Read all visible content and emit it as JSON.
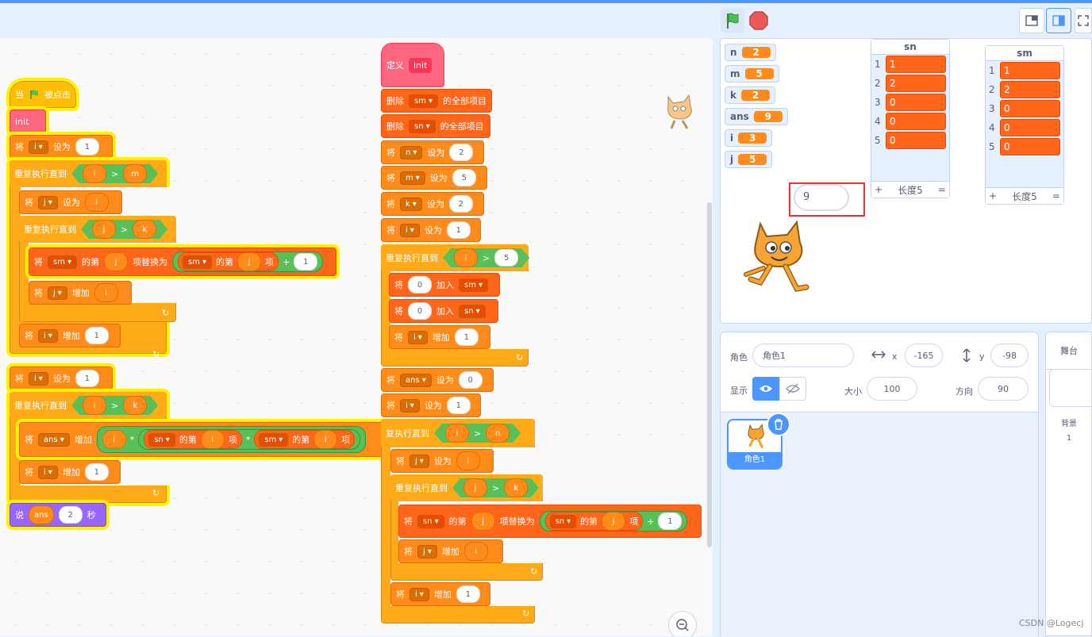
{
  "toolbar": {
    "flag": "green-flag",
    "stop": "stop-sign"
  },
  "script_main": {
    "hat": {
      "when": "当",
      "clicked": "被点击"
    },
    "call_init": "init",
    "set_i1": {
      "label": "将",
      "var": "i",
      "to": "设为",
      "value": "1"
    },
    "repeat1": {
      "label": "重复执行直到",
      "a": "i",
      "op": ">",
      "b": "m"
    },
    "set_j_i": {
      "label": "将",
      "var": "j",
      "to": "设为",
      "value": "i"
    },
    "repeat2": {
      "label": "重复执行直到",
      "a": "j",
      "op": ">",
      "b": "k"
    },
    "replace": {
      "label": "将",
      "list": "sm",
      "of": "的第",
      "idx": "j",
      "replace": "项替换为",
      "list2": "sm",
      "of2": "的第",
      "idx2": "j",
      "item": "项",
      "plus": "+",
      "num": "1"
    },
    "inc_j": {
      "label": "将",
      "var": "j",
      "inc": "增加",
      "value": "i"
    },
    "inc_i": {
      "label": "将",
      "var": "i",
      "inc": "增加",
      "value": "1"
    },
    "set_i2": {
      "label": "将",
      "var": "i",
      "to": "设为",
      "value": "1"
    },
    "repeat3": {
      "label": "重复执行直到",
      "a": "i",
      "op": ">",
      "b": "k"
    },
    "inc_ans": {
      "label": "将",
      "var": "ans",
      "inc": "增加",
      "a": "i",
      "mul": "*",
      "l1": "sn",
      "of1": "的第",
      "i1": "i",
      "item1": "项",
      "mul2": "*",
      "l2": "sm",
      "of2": "的第",
      "i2": "i",
      "item2": "项"
    },
    "inc_i2": {
      "label": "将",
      "var": "i",
      "inc": "增加",
      "value": "1"
    },
    "say": {
      "label": "说",
      "var": "ans",
      "secs": "2",
      "unit": "秒"
    }
  },
  "script_init": {
    "define": {
      "label": "定义",
      "name": "init"
    },
    "del_sm": {
      "label": "删除",
      "list": "sm",
      "rest": "的全部项目"
    },
    "del_sn": {
      "label": "删除",
      "list": "sn",
      "rest": "的全部项目"
    },
    "set_n": {
      "label": "将",
      "var": "n",
      "to": "设为",
      "value": "2"
    },
    "set_m": {
      "label": "将",
      "var": "m",
      "to": "设为",
      "value": "5"
    },
    "set_k": {
      "label": "将",
      "var": "k",
      "to": "设为",
      "value": "2"
    },
    "set_i": {
      "label": "将",
      "var": "i",
      "to": "设为",
      "value": "1"
    },
    "repeat1": {
      "label": "重复执行直到",
      "a": "i",
      "op": ">",
      "b": "5"
    },
    "add_sm": {
      "label": "将",
      "value": "0",
      "add": "加入",
      "list": "sm"
    },
    "add_sn": {
      "label": "将",
      "value": "0",
      "add": "加入",
      "list": "sn"
    },
    "inc_i": {
      "label": "将",
      "var": "i",
      "inc": "增加",
      "value": "1"
    },
    "set_ans": {
      "label": "将",
      "var": "ans",
      "to": "设为",
      "value": "0"
    },
    "set_i2": {
      "label": "将",
      "var": "i",
      "to": "设为",
      "value": "1"
    },
    "repeat2": {
      "label": "复执行直到",
      "a": "i",
      "op": ">",
      "b": "n"
    },
    "set_j": {
      "label": "将",
      "var": "j",
      "to": "设为",
      "value": "i"
    },
    "repeat3": {
      "label": "重复执行直到",
      "a": "j",
      "op": ">",
      "b": "k"
    },
    "replace": {
      "label": "将",
      "list": "sn",
      "of": "的第",
      "idx": "j",
      "replace": "项替换为",
      "list2": "sn",
      "of2": "的第",
      "idx2": "j",
      "item": "项",
      "plus": "+",
      "num": "1"
    },
    "inc_j": {
      "label": "将",
      "var": "j",
      "inc": "增加",
      "value": "i"
    },
    "inc_i2": {
      "label": "将",
      "var": "i",
      "inc": "增加",
      "value": "1"
    }
  },
  "monitors": [
    {
      "name": "n",
      "value": "2"
    },
    {
      "name": "m",
      "value": "5"
    },
    {
      "name": "k",
      "value": "2"
    },
    {
      "name": "ans",
      "value": "9"
    },
    {
      "name": "i",
      "value": "3"
    },
    {
      "name": "j",
      "value": "5"
    }
  ],
  "list_sn": {
    "title": "sn",
    "items": [
      "1",
      "2",
      "0",
      "0",
      "0"
    ],
    "indexes": [
      "1",
      "2",
      "3",
      "4",
      "5"
    ],
    "add": "+",
    "length": "长度5",
    "resize": "="
  },
  "list_sm": {
    "title": "sm",
    "items": [
      "1",
      "2",
      "0",
      "0",
      "0"
    ],
    "indexes": [
      "1",
      "2",
      "3",
      "4",
      "5"
    ],
    "add": "+",
    "length": "长度5",
    "resize": "="
  },
  "speech": "9",
  "sprite_info": {
    "sprite_label": "角色",
    "sprite_name": "角色1",
    "x_label": "x",
    "x": "-165",
    "y_label": "y",
    "y": "-98",
    "show_label": "显示",
    "size_label": "大小",
    "size": "100",
    "dir_label": "方向",
    "dir": "90"
  },
  "sprite_thumb": {
    "name": "角色1"
  },
  "stage_pane": {
    "title": "舞台",
    "backdrop_label": "背景",
    "backdrop_count": "1"
  },
  "watermark": "CSDN @Logecj",
  "colors": {
    "motion_blue": "#4c97ff",
    "control": "#ffab19",
    "variables": "#ff8c1a",
    "lists": "#ff661a",
    "operators": "#59c059",
    "myblocks": "#ff6680",
    "looks": "#9966ff",
    "events": "#ffbf00",
    "highlight": "#fff200"
  }
}
